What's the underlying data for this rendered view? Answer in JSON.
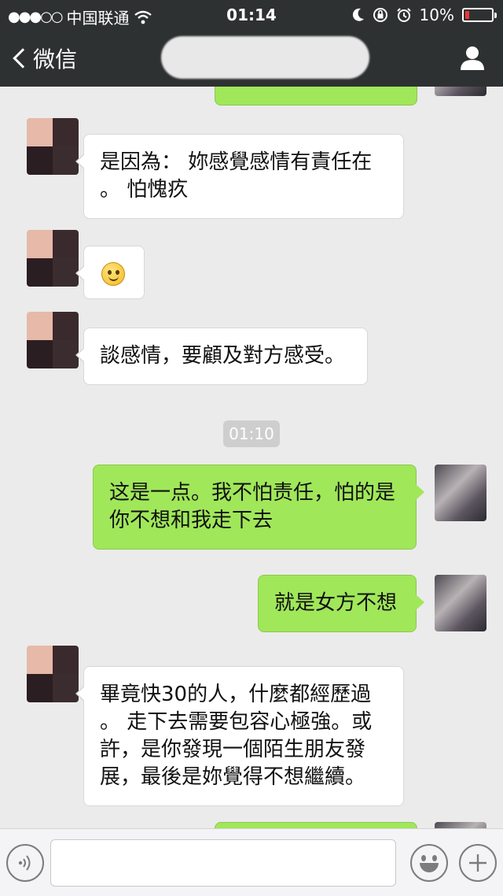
{
  "status_bar": {
    "carrier": "中国联通",
    "signal_dots": "●●●○○",
    "time": "01:14",
    "battery": "10%"
  },
  "nav": {
    "back_label": "微信"
  },
  "messages": [
    {
      "side": "right",
      "text": ""
    },
    {
      "side": "left",
      "text": "是因為： 妳感覺感情有責任在 。 怕愧疚"
    },
    {
      "side": "left",
      "text": "",
      "emoji": "smile"
    },
    {
      "side": "left",
      "text": "談感情，要顧及對方感受。"
    },
    {
      "side": "right",
      "text": "这是一点。我不怕责任，怕的是你不想和我走下去"
    },
    {
      "side": "right",
      "text": "就是女方不想"
    },
    {
      "side": "left",
      "text": "畢竟快30的人，什麼都經歷過 。 走下去需要包容心極強。或許，是你發現一個陌生朋友發展，最後是妳覺得不想繼續。"
    }
  ],
  "timestamp": "01:10",
  "colors": {
    "header": "#2e3132",
    "background": "#ebebeb",
    "bubble_self": "#a0e75a",
    "bubble_other": "#ffffff",
    "battery_low": "#e33333"
  },
  "icons": [
    "wifi-icon",
    "moon-icon",
    "orientation-lock-icon",
    "alarm-icon",
    "battery-icon",
    "back-chevron-icon",
    "profile-icon",
    "voice-icon",
    "emoji-icon",
    "plus-icon"
  ]
}
